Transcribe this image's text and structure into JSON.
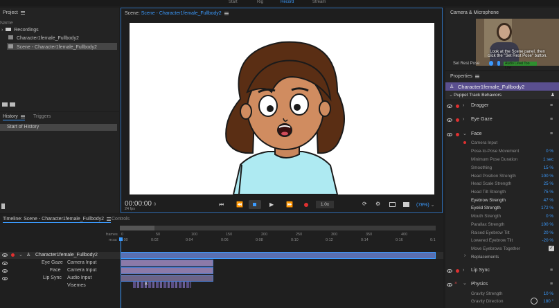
{
  "topbar": {
    "start": "Start",
    "rig": "Rig",
    "record": "Record",
    "stream": "Stream"
  },
  "project": {
    "title": "Project",
    "name_header": "Name",
    "items": [
      "Recordings",
      "Character1female_Fullbody2",
      "Scene - Character1female_Fullbody2"
    ]
  },
  "history": {
    "tab_history": "History",
    "tab_triggers": "Triggers",
    "items": [
      "Start of History"
    ]
  },
  "scene": {
    "title_prefix": "Scene: ",
    "title_name": "Scene - Character1female_Fullbody2",
    "timecode": "00:00:00",
    "timecode_frame": "0",
    "fps": "24 fps",
    "speed": "1.0x",
    "zoom": "(78%)"
  },
  "camera": {
    "title": "Camera & Microphone",
    "caption_line1": "Look at the Scene panel, then",
    "caption_line2": "click the \"Set Rest Pose\" button.",
    "set_rest_pose": "Set Rest Pose",
    "audio_level": "Audio Level Too Low"
  },
  "properties": {
    "title": "Properties",
    "puppet_name": "Character1female_Fullbody2",
    "section": "Puppet Track Behaviors",
    "behaviors": [
      {
        "name": "Dragger"
      },
      {
        "name": "Eye Gaze"
      },
      {
        "name": "Face"
      }
    ],
    "camera_input": "Camera Input",
    "face_params": [
      {
        "label": "Pose-to-Pose Movement",
        "value": "0 %"
      },
      {
        "label": "Minimum Pose Duration",
        "value": "1 sec"
      },
      {
        "label": "Smoothing",
        "value": "15 %"
      },
      {
        "label": "Head Position Strength",
        "value": "100 %"
      },
      {
        "label": "Head Scale Strength",
        "value": "25 %"
      },
      {
        "label": "Head Tilt Strength",
        "value": "75 %"
      },
      {
        "label": "Eyebrow Strength",
        "value": "47 %"
      },
      {
        "label": "Eyelid Strength",
        "value": "172 %"
      },
      {
        "label": "Mouth Strength",
        "value": "0 %"
      },
      {
        "label": "Parallax Strength",
        "value": "100 %"
      },
      {
        "label": "Raised Eyebrow Tilt",
        "value": "20 %"
      },
      {
        "label": "Lowered Eyebrow Tilt",
        "value": "-20 %"
      },
      {
        "label": "Move Eyebrows Together",
        "value": ""
      }
    ],
    "replacements": "Replacements",
    "lip_sync": "Lip Sync",
    "physics": "Physics",
    "physics_params": [
      {
        "label": "Gravity Strength",
        "value": "10 %"
      },
      {
        "label": "Gravity Direction",
        "value": "180 °"
      }
    ]
  },
  "timeline": {
    "title": "Timeline: Scene - Character1female_Fullbody2",
    "controls_tab": "Controls",
    "frames_label": "frames",
    "mss_label": "m:ss",
    "frame_ticks": [
      "0",
      "50",
      "100",
      "150",
      "200",
      "250",
      "300",
      "350",
      "400"
    ],
    "time_ticks": [
      "0:00",
      "0:02",
      "0:04",
      "0:06",
      "0:08",
      "0:10",
      "0:12",
      "0:14",
      "0:16",
      "0:1"
    ],
    "puppet_row": "Character1female_Fullbody2",
    "tracks": [
      {
        "name": "Eye Gaze",
        "input": "Camera Input"
      },
      {
        "name": "Face",
        "input": "Camera Input"
      },
      {
        "name": "Lip Sync",
        "input": "Audio Input"
      },
      {
        "name": "",
        "input": "Visemes"
      }
    ],
    "viseme_label": "B"
  },
  "colors": {
    "accent": "#3b9bff",
    "record": "#e03030",
    "puppet_highlight": "#5a4f8f",
    "track": "#8c7aa8"
  }
}
